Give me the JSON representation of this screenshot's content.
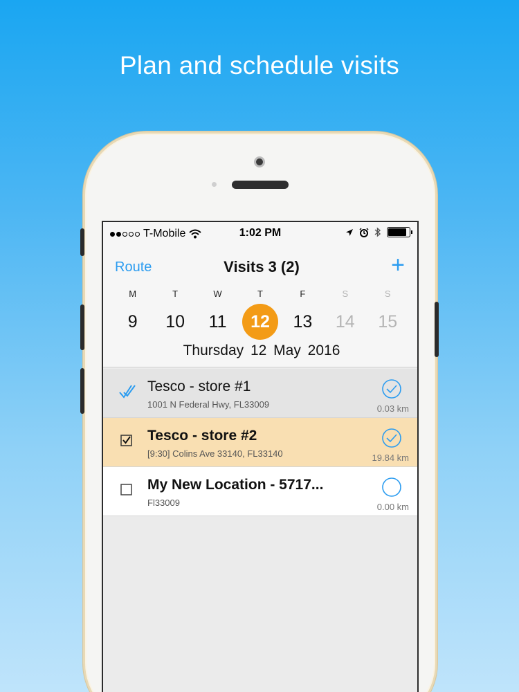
{
  "headline": "Plan and schedule visits",
  "status_bar": {
    "carrier": "T-Mobile",
    "time": "1:02 PM"
  },
  "nav": {
    "route_label": "Route",
    "title": "Visits 3 (2)",
    "add_label": "+"
  },
  "week": [
    {
      "label": "M",
      "num": "9"
    },
    {
      "label": "T",
      "num": "10"
    },
    {
      "label": "W",
      "num": "11"
    },
    {
      "label": "T",
      "num": "12"
    },
    {
      "label": "F",
      "num": "13"
    },
    {
      "label": "S",
      "num": "14"
    },
    {
      "label": "S",
      "num": "15"
    }
  ],
  "selected_date": "Thursday  12 May 2016",
  "visits": [
    {
      "name": "Tesco - store #1",
      "address": "1001 N Federal Hwy, FL33009",
      "distance": "0.03 km"
    },
    {
      "name": "Tesco - store #2",
      "address": "[9:30] Colins Ave 33140, FL33140",
      "distance": "19.84 km"
    },
    {
      "name": "My New Location - 5717...",
      "address": "Fl33009",
      "distance": "0.00 km"
    }
  ],
  "colors": {
    "accent": "#2b9cf0",
    "selected_day": "#f39b16",
    "active_row": "#f9dfb2"
  }
}
